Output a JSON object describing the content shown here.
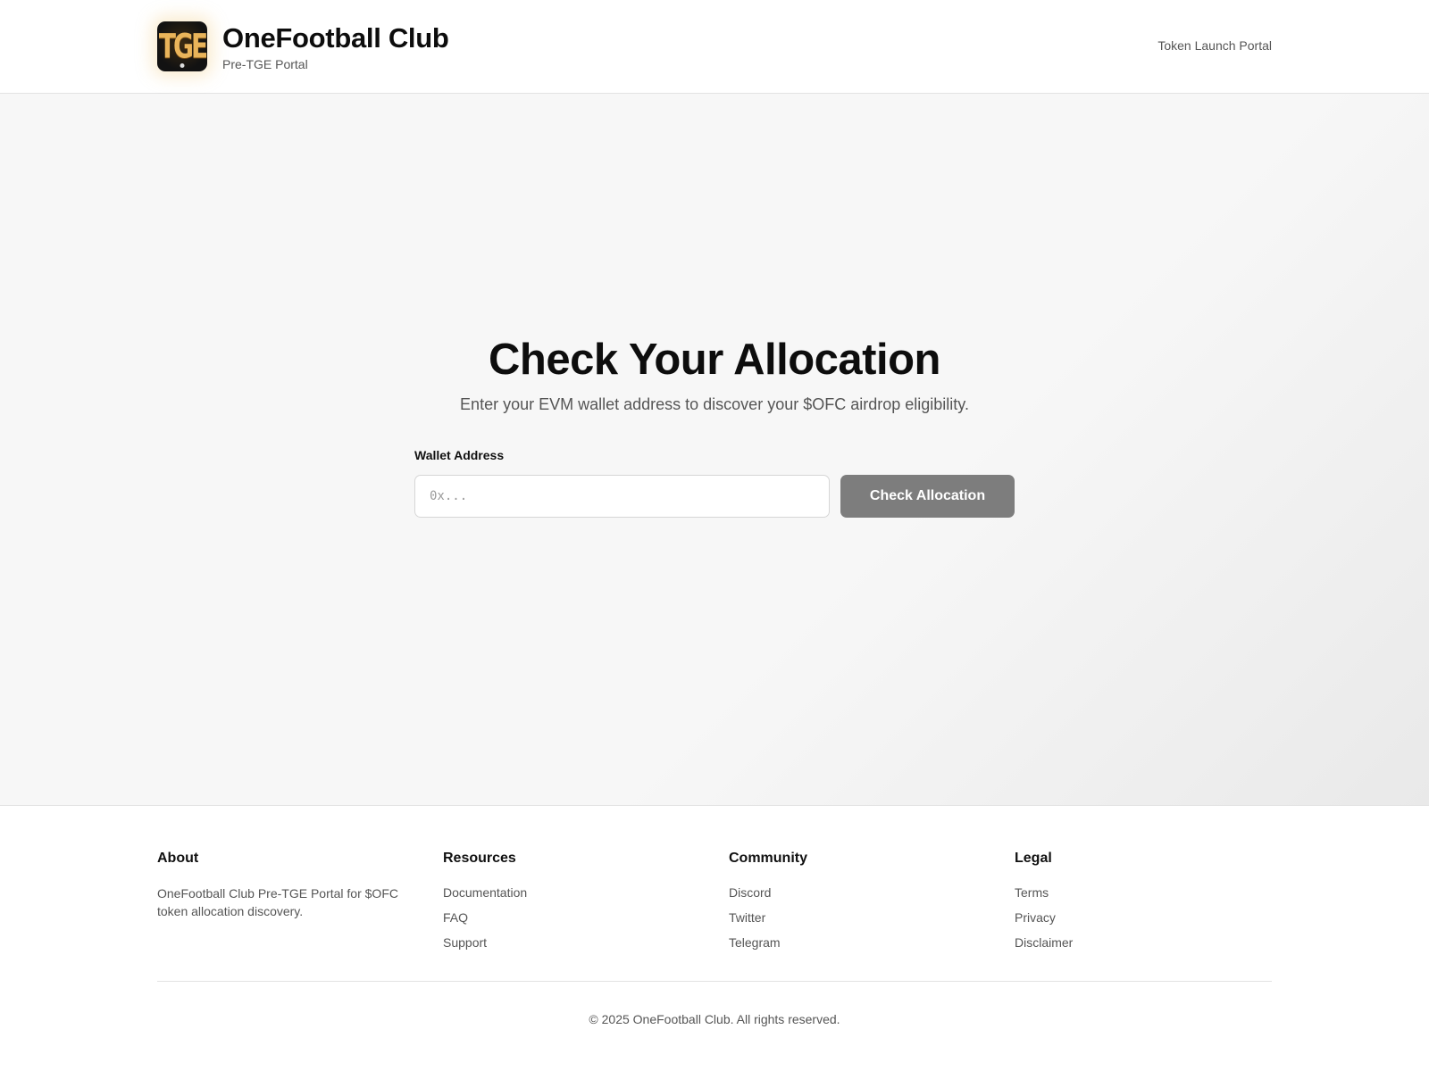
{
  "header": {
    "logo_text": "TGE",
    "title": "OneFootball Club",
    "subtitle": "Pre-TGE Portal",
    "nav_link": "Token Launch Portal"
  },
  "hero": {
    "title": "Check Your Allocation",
    "subtitle": "Enter your EVM wallet address to discover your $OFC airdrop eligibility.",
    "wallet_label": "Wallet Address",
    "wallet_placeholder": "0x...",
    "wallet_value": "",
    "check_button": "Check Allocation"
  },
  "footer": {
    "about": {
      "heading": "About",
      "text": "OneFootball Club Pre-TGE Portal for $OFC token allocation discovery."
    },
    "resources": {
      "heading": "Resources",
      "links": [
        "Documentation",
        "FAQ",
        "Support"
      ]
    },
    "community": {
      "heading": "Community",
      "links": [
        "Discord",
        "Twitter",
        "Telegram"
      ]
    },
    "legal": {
      "heading": "Legal",
      "links": [
        "Terms",
        "Privacy",
        "Disclaimer"
      ]
    },
    "copyright": "© 2025 OneFootball Club. All rights reserved."
  },
  "colors": {
    "button_bg": "#7d7d7d",
    "logo_gold": "#e9b45a",
    "hero_bg": "#f7f7f7"
  },
  "icons": {
    "logo": "tge-logo-icon"
  }
}
